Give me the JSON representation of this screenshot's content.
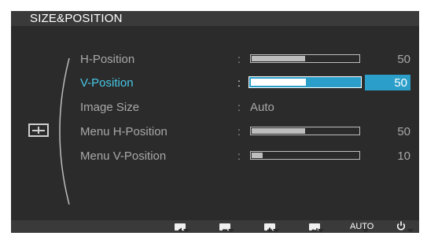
{
  "osd": {
    "title": "SIZE&POSITION",
    "menu": [
      {
        "label": "H-Position",
        "type": "slider",
        "value": 50,
        "max": 100,
        "value_text": "50",
        "selected": false
      },
      {
        "label": "V-Position",
        "type": "slider",
        "value": 50,
        "max": 100,
        "value_text": "50",
        "selected": true
      },
      {
        "label": "Image Size",
        "type": "text",
        "value_text": "Auto",
        "selected": false
      },
      {
        "label": "Menu H-Position",
        "type": "slider",
        "value": 50,
        "max": 100,
        "value_text": "50",
        "selected": false
      },
      {
        "label": "Menu V-Position",
        "type": "slider",
        "value": 10,
        "max": 100,
        "value_text": "10",
        "selected": false
      }
    ],
    "separator": ":",
    "footer": {
      "buttons": [
        {
          "name": "left-arrow-icon"
        },
        {
          "name": "minus-icon"
        },
        {
          "name": "plus-icon"
        },
        {
          "name": "enter-icon"
        },
        {
          "name": "auto-button",
          "label": "AUTO"
        },
        {
          "name": "power-icon"
        }
      ]
    },
    "colors": {
      "background": "#2b2b2b",
      "accent": "#2b9fc9",
      "selected_label": "#46c8e8",
      "text": "#a8a8a8"
    }
  }
}
